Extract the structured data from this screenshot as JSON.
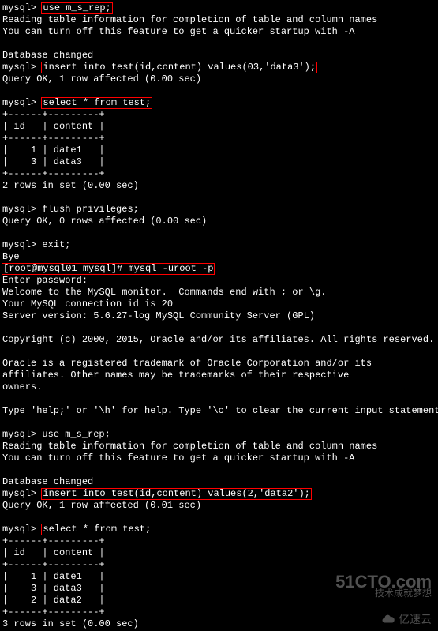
{
  "prompts": {
    "mysql": "mysql> ",
    "shell": "[root@mysql01 mysql]# "
  },
  "commands": {
    "use1": "use m_s_rep;",
    "insert1": "insert into test(id,content) values(03,'data3');",
    "select1": "select * from test;",
    "flush": "flush privileges;",
    "exit": "exit;",
    "shell_mysql": "mysql -uroot -p",
    "use2": "use m_s_rep;",
    "insert2": "insert into test(id,content) values(2,'data2');",
    "select2": "select * from test;"
  },
  "output": {
    "reading_table": "Reading table information for completion of table and column names",
    "turn_off": "You can turn off this feature to get a quicker startup with -A",
    "db_changed": "Database changed",
    "query_ok_1row_000": "Query OK, 1 row affected (0.00 sec)",
    "query_ok_0rows_000": "Query OK, 0 rows affected (0.00 sec)",
    "query_ok_1row_001": "Query OK, 1 row affected (0.01 sec)",
    "bye": "Bye",
    "enter_password": "Enter password:",
    "welcome": "Welcome to the MySQL monitor.  Commands end with ; or \\g.",
    "conn_id": "Your MySQL connection id is 20",
    "server_version": "Server version: 5.6.27-log MySQL Community Server (GPL)",
    "copyright": "Copyright (c) 2000, 2015, Oracle and/or its affiliates. All rights reserved.",
    "trademark1": "Oracle is a registered trademark of Oracle Corporation and/or its",
    "trademark2": "affiliates. Other names may be trademarks of their respective",
    "trademark3": "owners.",
    "help": "Type 'help;' or '\\h' for help. Type '\\c' to clear the current input statement.",
    "table_border": "+------+---------+",
    "table_header": "| id   | content |",
    "row1": "|    1 | date1   |",
    "row3": "|    3 | data3   |",
    "row2": "|    2 | data2   |",
    "rows_2": "2 rows in set (0.00 sec)",
    "rows_3": "3 rows in set (0.00 sec)"
  },
  "watermarks": {
    "cto_big": "51CTO.com",
    "cto_small": "技术成就梦想",
    "yisu": "亿速云"
  }
}
